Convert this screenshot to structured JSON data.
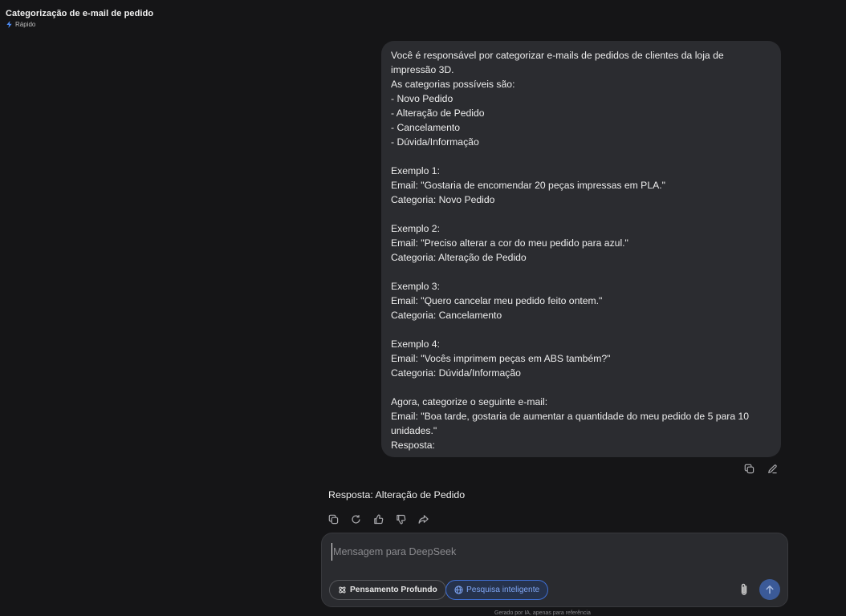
{
  "header": {
    "title": "Categorização de e-mail de pedido",
    "mode": "Rápido"
  },
  "user_message": {
    "lines": [
      "Você é responsável por categorizar e-mails de pedidos de clientes da loja de",
      "impressão 3D.",
      "As categorias possíveis são:",
      "- Novo Pedido",
      "- Alteração de Pedido",
      "- Cancelamento",
      "- Dúvida/Informação",
      "",
      "Exemplo 1:",
      "Email: \"Gostaria de encomendar 20 peças impressas em PLA.\"",
      "Categoria: Novo Pedido",
      "",
      "Exemplo 2:",
      "Email: \"Preciso alterar a cor do meu pedido para azul.\"",
      "Categoria: Alteração de Pedido",
      "",
      "Exemplo 3:",
      "Email: \"Quero cancelar meu pedido feito ontem.\"",
      "Categoria: Cancelamento",
      "",
      "Exemplo 4:",
      "Email: \"Vocês imprimem peças em ABS também?\"",
      "Categoria: Dúvida/Informação",
      "",
      "Agora, categorize o seguinte e-mail:",
      "Email: \"Boa tarde, gostaria de aumentar a quantidade do meu pedido de 5 para 10",
      "unidades.\"",
      "Resposta:"
    ]
  },
  "assistant_message": {
    "text": "Resposta: Alteração de Pedido"
  },
  "composer": {
    "placeholder": "Mensagem para DeepSeek",
    "deep_think_label": "Pensamento Profundo",
    "search_label": "Pesquisa inteligente"
  },
  "footer": {
    "note": "Gerado por IA, apenas para referência"
  },
  "colors": {
    "background": "#151517",
    "bubble": "#2b2c30",
    "accent": "#3f6fd4",
    "send": "#3b5a98"
  }
}
